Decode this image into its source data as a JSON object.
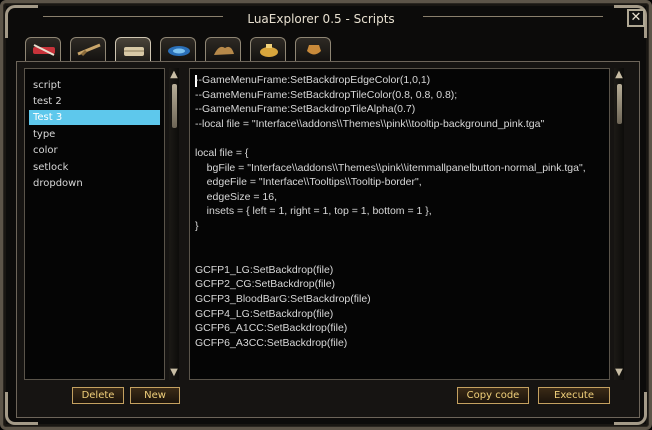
{
  "window": {
    "title": "LuaExplorer 0.5 - Scripts",
    "close_glyph": "✕"
  },
  "tabs": [
    {
      "icon": "swords-icon",
      "active": false
    },
    {
      "icon": "rifle-icon",
      "active": false
    },
    {
      "icon": "scroll-icon",
      "active": true
    },
    {
      "icon": "gem-icon",
      "active": false
    },
    {
      "icon": "beast-icon",
      "active": false
    },
    {
      "icon": "pouch-icon",
      "active": false
    },
    {
      "icon": "urn-icon",
      "active": false
    }
  ],
  "scripts": {
    "items": [
      "script",
      "test 2",
      "Test 3",
      "type",
      "color",
      "setlock",
      "dropdown"
    ],
    "selected_index": 2
  },
  "editor": {
    "code": "--GameMenuFrame:SetBackdropEdgeColor(1,0,1)\n--GameMenuFrame:SetBackdropTileColor(0.8, 0.8, 0.8);\n--GameMenuFrame:SetBackdropTileAlpha(0.7)\n--local file = \"Interface\\\\addons\\\\Themes\\\\pink\\\\tooltip-background_pink.tga\"\n\nlocal file = {\n    bgFile = \"Interface\\\\addons\\\\Themes\\\\pink\\\\itemmallpanelbutton-normal_pink.tga\",\n    edgeFile = \"Interface\\\\Tooltips\\\\Tooltip-border\",\n    edgeSize = 16,\n    insets = { left = 1, right = 1, top = 1, bottom = 1 },\n}\n\n\nGCFP1_LG:SetBackdrop(file)\nGCFP2_CG:SetBackdrop(file)\nGCFP3_BloodBarG:SetBackdrop(file)\nGCFP4_LG:SetBackdrop(file)\nGCFP6_A1CC:SetBackdrop(file)\nGCFP6_A3CC:SetBackdrop(file)"
  },
  "buttons": {
    "delete": "Delete",
    "new": "New",
    "copy_code": "Copy code",
    "execute": "Execute"
  },
  "scroll": {
    "up_glyph": "▲",
    "down_glyph": "▼"
  },
  "colors": {
    "selection": "#5ec8ec",
    "button_text": "#f0cf7a",
    "button_border": "#c4a160"
  }
}
